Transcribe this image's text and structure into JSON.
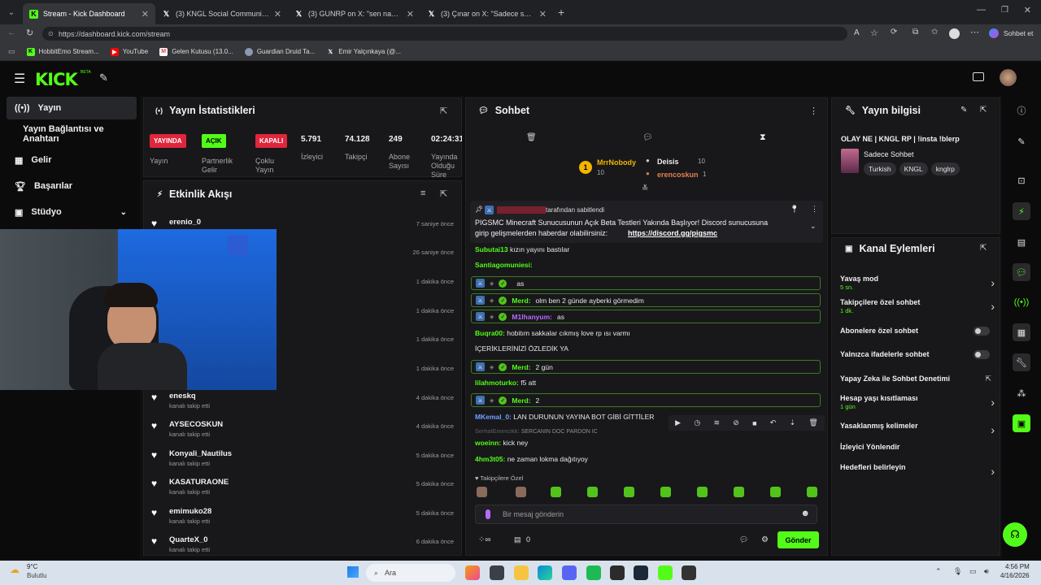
{
  "browser": {
    "tabs": [
      {
        "icon": "kick-icon",
        "title": "Stream - Kick Dashboard",
        "active": true
      },
      {
        "icon": "x-icon",
        "title": "(3) KNGL Social Community / X"
      },
      {
        "icon": "x-icon",
        "title": "(3) GUNRP on X: \"sen napıyordun"
      },
      {
        "icon": "x-icon",
        "title": "(3) Çınar on X: \"Sadece satranç at"
      }
    ],
    "url": "https://dashboard.kick.com/stream",
    "profile_label": "Sohbet et",
    "bookmarks": [
      "HobbitEmo Stream...",
      "YouTube",
      "Gelen Kutusu (13.0...",
      "Guardian Druid Ta...",
      "Emir Yalçınkaya (@..."
    ]
  },
  "sidebar": {
    "items": [
      "Yayın",
      "Yayın Bağlantısı ve Anahtarı",
      "Gelir",
      "Başarılar",
      "Stüdyo"
    ]
  },
  "stats": {
    "title": "Yayın İstatistikleri",
    "badges": [
      {
        "text": "YAYINDA",
        "label": "Yayın",
        "color": "#e0263c"
      },
      {
        "text": "AÇIK",
        "label": "Partnerlik Gelir",
        "color": "#53fc18"
      },
      {
        "text": "KAPALI",
        "label": "Çoklu Yayın",
        "color": "#e0263c"
      }
    ],
    "numbers": [
      {
        "value": "5.791",
        "label": "İzleyici"
      },
      {
        "value": "74.128",
        "label": "Takipçi"
      },
      {
        "value": "249",
        "label": "Abone Sayısı"
      },
      {
        "value": "02:24:31",
        "label": "Yayında Olduğu Süre"
      }
    ]
  },
  "activity": {
    "title": "Etkinlik Akışı",
    "events": [
      {
        "name": "erenio_0",
        "sub": "",
        "time": "7 saniye önce"
      },
      {
        "name": "",
        "sub": "",
        "time": "26 saniye önce"
      },
      {
        "name": "",
        "sub": "",
        "time": "1 dakika önce"
      },
      {
        "name": "",
        "sub": "",
        "time": "1 dakika önce"
      },
      {
        "name": "",
        "sub": "",
        "time": "1 dakika önce"
      },
      {
        "name": "",
        "sub": "",
        "time": "1 dakika önce"
      },
      {
        "name": "eneskq",
        "sub": "kanalı takip etti",
        "time": "4 dakika önce"
      },
      {
        "name": "AYSECOSKUN",
        "sub": "kanalı takip etti",
        "time": "4 dakika önce"
      },
      {
        "name": "Konyali_Nautilus",
        "sub": "kanalı takip etti",
        "time": "5 dakika önce"
      },
      {
        "name": "KASATURAONE",
        "sub": "kanalı takip etti",
        "time": "5 dakika önce"
      },
      {
        "name": "emimuko28",
        "sub": "kanalı takip etti",
        "time": "5 dakika önce"
      },
      {
        "name": "QuarteX_0",
        "sub": "kanalı takip etti",
        "time": "6 dakika önce"
      }
    ]
  },
  "chat": {
    "title": "Sohbet",
    "leader": {
      "rank": "1",
      "name": "MrrNobody",
      "count": "10",
      "second_name": "Deisis",
      "second_count": "10",
      "third_name": "erencoskun",
      "third_count": "1"
    },
    "pinned_by": "tarafından sabitlendi",
    "pinned_text": "PIGSMC Minecraft Sunucusunun Açık Beta Testleri Yakında Başlıyor! Discord sunucusuna",
    "pinned_text2": "girip gelişmelerden haberdar olabilirsiniz:",
    "pinned_link": "https://discord.gg/pigsmc",
    "messages": [
      {
        "user": "Subutai13",
        "text": "kızın yayını bastılar",
        "ucolor": "#53fc18"
      },
      {
        "user": "Santiagomuniesi:",
        "text": "",
        "ucolor": "#53fc18"
      },
      {
        "user": "",
        "text": "as",
        "ucolor": "#e0263c",
        "boxed": true
      },
      {
        "user": "Merd:",
        "text": "olm ben 2 günde ayberki görmedim",
        "ucolor": "#53fc18",
        "boxed": true
      },
      {
        "user": "M1lhanyum:",
        "text": "as",
        "ucolor": "#b56cff",
        "boxed": true
      },
      {
        "user": "Buqra00:",
        "text": "hobitım sakkalar cıkmış love rp ısı varmı",
        "ucolor": "#53fc18"
      },
      {
        "user": "",
        "text": "İÇERİKLERİNİZİ ÖZLEDİK YA",
        "ucolor": "#e0263c"
      },
      {
        "user": "Merd:",
        "text": "2 gün",
        "ucolor": "#53fc18",
        "boxed": true
      },
      {
        "user": "lilahmoturko:",
        "text": "f5 att",
        "ucolor": "#53fc18"
      },
      {
        "user": "Merd:",
        "text": "2",
        "ucolor": "#53fc18",
        "boxed": true
      },
      {
        "user": "MKemal_0:",
        "text": "LAN DURUNUN YAYINA BOT GİBİ GİTTİLER",
        "ucolor": "#6fa0ff"
      },
      {
        "user": "SerhatEmincikk:",
        "text": "SERCANIN DOC PARDON IC",
        "ucolor": "#777"
      },
      {
        "user": "woeinn:",
        "text": "kick ney",
        "ucolor": "#53fc18"
      },
      {
        "user": "4hm3t05:",
        "text": "ne zaman lokma dağıtıyoy",
        "ucolor": "#53fc18"
      }
    ],
    "followers_label": "Takipçilere Özel",
    "input_placeholder": "Bir mesaj gönderin",
    "send_label": "Gönder",
    "bottom_count": "0"
  },
  "stream_info": {
    "title": "Yayın bilgisi",
    "stream_title": "OLAY NE | KNGL RP | !insta !blerp",
    "category": "Sadece Sohbet",
    "tags": [
      "Turkish",
      "KNGL",
      "knglrp"
    ]
  },
  "channel_actions": {
    "title": "Kanal Eylemleri",
    "items": [
      {
        "label": "Yavaş mod",
        "sub": "5 sn.",
        "control": "chevron"
      },
      {
        "label": "Takipçilere özel sohbet",
        "sub": "1 dk.",
        "control": "chevron"
      },
      {
        "label": "Abonelere özel sohbet",
        "sub": "",
        "control": "toggle"
      },
      {
        "label": "Yalnızca ifadelerle sohbet",
        "sub": "",
        "control": "toggle"
      },
      {
        "label": "Yapay Zeka ile Sohbet Denetimi",
        "sub": "",
        "control": "external"
      },
      {
        "label": "Hesap yaşı kısıtlaması",
        "sub": "1 gün",
        "control": "chevron"
      },
      {
        "label": "Yasaklanmış kelimeler",
        "sub": "",
        "control": "chevron"
      },
      {
        "label": "İzleyici Yönlendir",
        "sub": "",
        "control": ""
      },
      {
        "label": "Hedefleri belirleyin",
        "sub": "",
        "control": "chevron"
      }
    ]
  },
  "taskbar": {
    "weather_temp": "9°C",
    "weather_label": "Bulutlu",
    "search": "Ara",
    "time": "4:56 PM",
    "date": "4/16/2026"
  },
  "colors": {
    "accent": "#53fc18",
    "live": "#e0263c",
    "panel": "#18181b",
    "bg": "#0b0b0c"
  }
}
